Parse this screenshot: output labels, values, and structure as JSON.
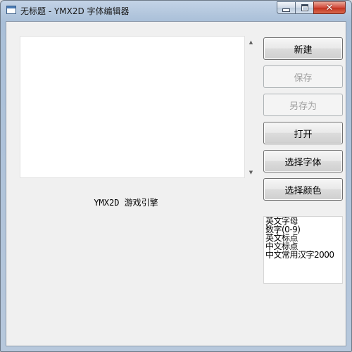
{
  "window": {
    "title": "无标题 - YMX2D 字体编辑器",
    "controls": {
      "minimize": "minimize",
      "maximize": "maximize",
      "close": "close"
    }
  },
  "preview": {
    "label": "YMX2D 游戏引擎"
  },
  "buttons": {
    "new": {
      "label": "新建",
      "enabled": true
    },
    "save": {
      "label": "保存",
      "enabled": false
    },
    "save_as": {
      "label": "另存为",
      "enabled": false
    },
    "open": {
      "label": "打开",
      "enabled": true
    },
    "select_font": {
      "label": "选择字体",
      "enabled": true
    },
    "select_color": {
      "label": "选择颜色",
      "enabled": true
    }
  },
  "charset_list": {
    "items": [
      "英文字母",
      "数字(0-9)",
      "英文标点",
      "中文标点",
      "中文常用汉字2000"
    ]
  },
  "icons": {
    "app": "window-icon",
    "scroll_up": "arrow-up-icon",
    "scroll_down": "arrow-down-icon"
  }
}
